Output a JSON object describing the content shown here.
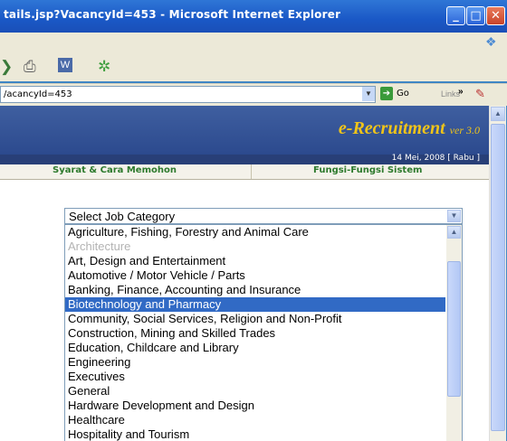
{
  "window": {
    "title": "tails.jsp?VacancyId=453 - Microsoft Internet Explorer",
    "buttons": {
      "minimize": "_",
      "maximize": "□",
      "close": "✕"
    }
  },
  "toolbar": {
    "icons": [
      "back-arrow-icon",
      "print-icon",
      "word-icon",
      "messenger-icon"
    ]
  },
  "address_bar": {
    "url": "/acancyId=453",
    "go_label": "Go",
    "links_label": "Links",
    "more": "»"
  },
  "banner": {
    "title": "e-Recruitment",
    "version": "ver 3.0",
    "date": "14 Mei, 2008 [ Rabu ]"
  },
  "nav": {
    "items": [
      "Syarat & Cara Memohon",
      "Fungsi-Fungsi Sistem"
    ]
  },
  "job_category": {
    "selected": "Select Job Category",
    "options": [
      {
        "label": "Agriculture, Fishing, Forestry and Animal Care",
        "state": "normal"
      },
      {
        "label": "Architecture",
        "state": "disabled"
      },
      {
        "label": "Art, Design and Entertainment",
        "state": "normal"
      },
      {
        "label": "Automotive / Motor Vehicle / Parts",
        "state": "normal"
      },
      {
        "label": "Banking, Finance, Accounting and Insurance",
        "state": "normal"
      },
      {
        "label": "Biotechnology and Pharmacy",
        "state": "selected"
      },
      {
        "label": "Community, Social Services, Religion and Non-Profit",
        "state": "normal"
      },
      {
        "label": "Construction, Mining and Skilled Trades",
        "state": "normal"
      },
      {
        "label": "Education, Childcare and Library",
        "state": "normal"
      },
      {
        "label": "Engineering",
        "state": "normal"
      },
      {
        "label": "Executives",
        "state": "normal"
      },
      {
        "label": "General",
        "state": "normal"
      },
      {
        "label": "Hardware Development and Design",
        "state": "normal"
      },
      {
        "label": "Healthcare",
        "state": "normal"
      },
      {
        "label": "Hospitality and Tourism",
        "state": "normal"
      }
    ]
  },
  "colors": {
    "window_frame": "#3f86c4",
    "banner_bg": "#2c4a8e",
    "banner_title": "#f0c419",
    "nav_text": "#2d7a2d",
    "selection": "#316ac5"
  }
}
